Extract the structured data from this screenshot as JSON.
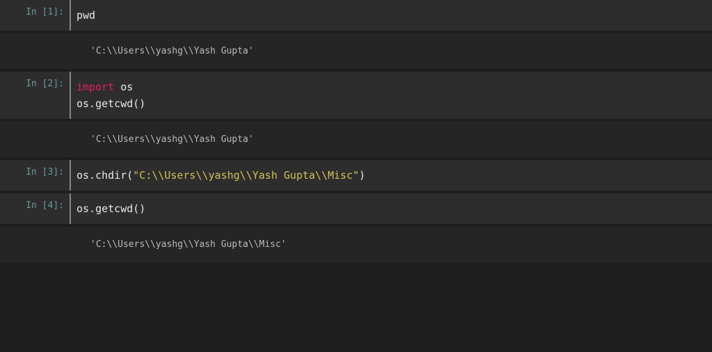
{
  "cells": [
    {
      "prompt": "In [1]:",
      "code_plain": "pwd"
    },
    {
      "output": "'C:\\\\Users\\\\yashg\\\\Yash Gupta'"
    },
    {
      "prompt": "In [2]:",
      "line1_keyword": "import",
      "line1_module": " os",
      "line2": "os.getcwd()"
    },
    {
      "output": "'C:\\\\Users\\\\yashg\\\\Yash Gupta'"
    },
    {
      "prompt": "In [3]:",
      "method_part": "os.chdir(",
      "string_part": "\"C:\\\\Users\\\\yashg\\\\Yash Gupta\\\\Misc\"",
      "close_part": ")"
    },
    {
      "prompt": "In [4]:",
      "code_plain": "os.getcwd()"
    },
    {
      "output": "'C:\\\\Users\\\\yashg\\\\Yash Gupta\\\\Misc'"
    }
  ]
}
